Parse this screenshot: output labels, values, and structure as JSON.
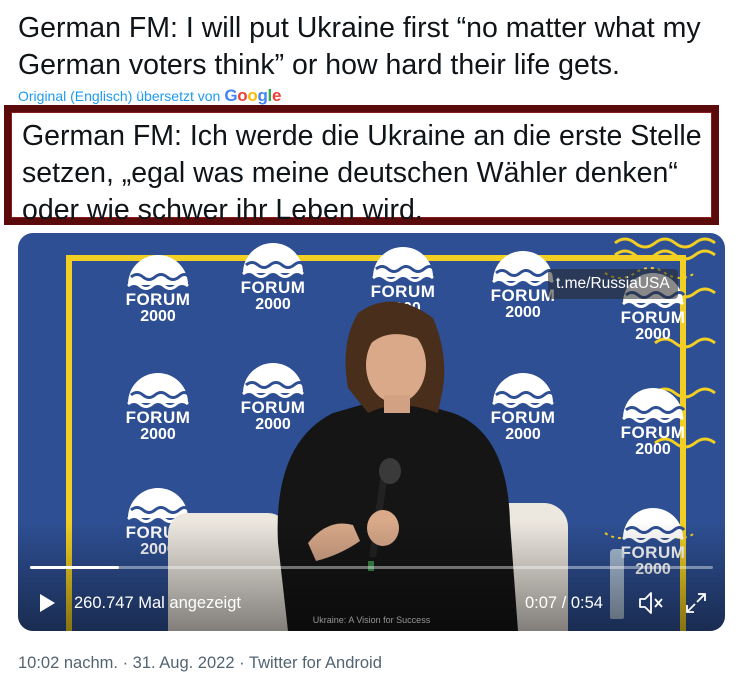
{
  "tweet": {
    "original_text": "German FM: I will put Ukraine first “no matter what my German voters think” or how hard their life gets.",
    "translated_by_label": "Original (Englisch) übersetzt von",
    "translation_provider": "Google",
    "translated_text": "German FM: Ich werde die Ukraine an die erste Stelle setzen, „egal was meine deutschen Wähler denken“ oder wie schwer ihr Leben wird.",
    "highlight_color": "#5a0a0a"
  },
  "video": {
    "watermark": "t.me/RussiaUSA",
    "views": "260.747 Mal angezeigt",
    "time": "0:07 / 0:54",
    "progress": 0.13,
    "caption": "Ukraine: A Vision for Success",
    "backdrop_text": {
      "forum_word": "FORUM",
      "year": "2000"
    },
    "colors": {
      "backdrop": "#2e4f93",
      "frame": "#f2cf22"
    },
    "icons": {
      "play": "play-icon",
      "mute": "mute-icon",
      "fullscreen": "fullscreen-icon"
    }
  },
  "footer": {
    "time": "10:02 nachm.",
    "date": "31. Aug. 2022",
    "source": "Twitter for Android",
    "separator": "·"
  }
}
